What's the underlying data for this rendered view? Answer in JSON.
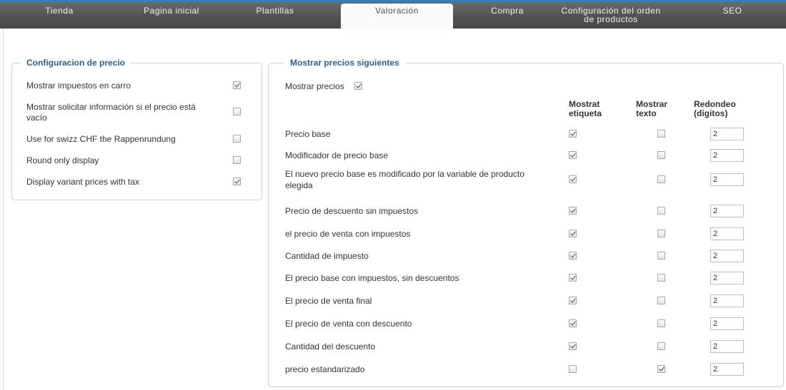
{
  "tabs": [
    {
      "label": "Tienda"
    },
    {
      "label": "Pagina inicial"
    },
    {
      "label": "Plantillas"
    },
    {
      "label": "Valoración"
    },
    {
      "label": "Compra"
    },
    {
      "label": "Configuración del orden de productos"
    },
    {
      "label": "SEO"
    }
  ],
  "tab_config_line1": "Configuración del orden",
  "tab_config_line2": "de productos",
  "active_tab": "Valoración",
  "price_config": {
    "legend": "Configuracion de precio",
    "items": [
      {
        "label": "Mostrar impuestos en carro",
        "checked": true
      },
      {
        "label": "Mostrar solicitar información si el precio está vacío",
        "label_line1": "Mostrar solicitar información si el precio está",
        "label_line2": "vacío",
        "checked": false
      },
      {
        "label": "Use for swizz CHF the Rappenrundung",
        "checked": false
      },
      {
        "label": "Round only display",
        "checked": false
      },
      {
        "label": "Display variant prices with tax",
        "checked": true
      }
    ]
  },
  "show_prices": {
    "legend": "Mostrar precios siguientes",
    "toggle_label": "Mostrar precios",
    "toggle_checked": true,
    "col_label": "Mostrat etiqueta",
    "col_label_l1": "Mostrat",
    "col_label_l2": "etiqueta",
    "col_text": "Mostrar texto",
    "col_text_l1": "Mostrar",
    "col_text_l2": "texto",
    "col_round": "Redondeo (digitos)",
    "col_round_l1": "Redondeo",
    "col_round_l2": "(digitos)",
    "rows": [
      {
        "label": "Precio base",
        "show_label": true,
        "show_text": false,
        "round": "2"
      },
      {
        "label": "Modificador de precio base",
        "show_label": true,
        "show_text": false,
        "round": "2"
      },
      {
        "label": "El nuevo precio base es modificado por la variable de producto elegida",
        "label_line1": "El nuevo precio base es modificado por la variable de producto",
        "label_line2": "elegida",
        "show_label": true,
        "show_text": false,
        "round": "2"
      },
      {
        "label": "Precio de descuento sin impuestos",
        "show_label": true,
        "show_text": false,
        "round": "2"
      },
      {
        "label": "el precio de venta con impuestos",
        "show_label": true,
        "show_text": false,
        "round": "2"
      },
      {
        "label": "Cantidad de impuesto",
        "show_label": true,
        "show_text": false,
        "round": "2"
      },
      {
        "label": "El precio base con impuestos, sin descuentos",
        "show_label": true,
        "show_text": false,
        "round": "2"
      },
      {
        "label": "El precio de venta final",
        "show_label": true,
        "show_text": false,
        "round": "2"
      },
      {
        "label": "El precio de venta con descuento",
        "show_label": true,
        "show_text": false,
        "round": "2"
      },
      {
        "label": "Cantidad del descuento",
        "show_label": true,
        "show_text": false,
        "round": "2"
      },
      {
        "label": "precio estandarizado",
        "show_label": false,
        "show_text": true,
        "round": "2"
      }
    ]
  },
  "colors": {
    "accent": "#2f7fc2",
    "legend": "#2e5f8a",
    "tabbar": "#525252"
  }
}
